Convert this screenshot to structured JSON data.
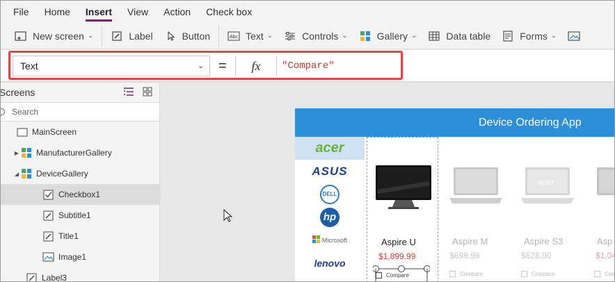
{
  "menu": {
    "items": [
      "File",
      "Home",
      "Insert",
      "View",
      "Action",
      "Check box"
    ],
    "active": "Insert"
  },
  "toolbar": {
    "new_screen": "New screen",
    "label": "Label",
    "button": "Button",
    "text": "Text",
    "controls": "Controls",
    "gallery": "Gallery",
    "data_table": "Data table",
    "forms": "Forms"
  },
  "formula": {
    "property": "Text",
    "equals": "=",
    "fx": "fx",
    "value": "\"Compare\""
  },
  "left_panel": {
    "title": "Screens",
    "search_placeholder": "Search",
    "tree": [
      {
        "label": "MainScreen",
        "indent": 0,
        "arrow": "",
        "icon": "screen-icon"
      },
      {
        "label": "ManufacturerGallery",
        "indent": 1,
        "arrow": "▶",
        "icon": "gallery-icon"
      },
      {
        "label": "DeviceGallery",
        "indent": 1,
        "arrow": "◢",
        "icon": "gallery-icon"
      },
      {
        "label": "Checkbox1",
        "indent": 2,
        "arrow": "",
        "icon": "checkbox-icon",
        "selected": true
      },
      {
        "label": "Subtitle1",
        "indent": 2,
        "arrow": "",
        "icon": "label-icon"
      },
      {
        "label": "Title1",
        "indent": 2,
        "arrow": "",
        "icon": "label-icon"
      },
      {
        "label": "Image1",
        "indent": 2,
        "arrow": "",
        "icon": "image-icon"
      },
      {
        "label": "Label3",
        "indent": 1,
        "arrow": "",
        "icon": "label-icon"
      }
    ]
  },
  "app": {
    "title": "Device Ordering App",
    "manufacturers": [
      "acer",
      "ASUS",
      "DELL",
      "hp",
      "Microsoft",
      "lenovo"
    ],
    "devices": [
      {
        "name": "Aspire U",
        "price": "$1,899.99",
        "checkbox": "Compare",
        "faded": false
      },
      {
        "name": "Aspire M",
        "price": "$699.99",
        "checkbox": "Compare",
        "faded": true
      },
      {
        "name": "Aspire S3",
        "price": "$628.00",
        "checkbox": "Compare",
        "faded": true
      },
      {
        "name": "Asp",
        "price": "$1,04",
        "checkbox": "Compare",
        "faded": true
      }
    ]
  },
  "colors": {
    "accent": "#742774",
    "header_blue": "#2d8fd8",
    "highlight_red": "#e04646",
    "price_red": "#e03c31",
    "formula_string": "#c0392b"
  }
}
